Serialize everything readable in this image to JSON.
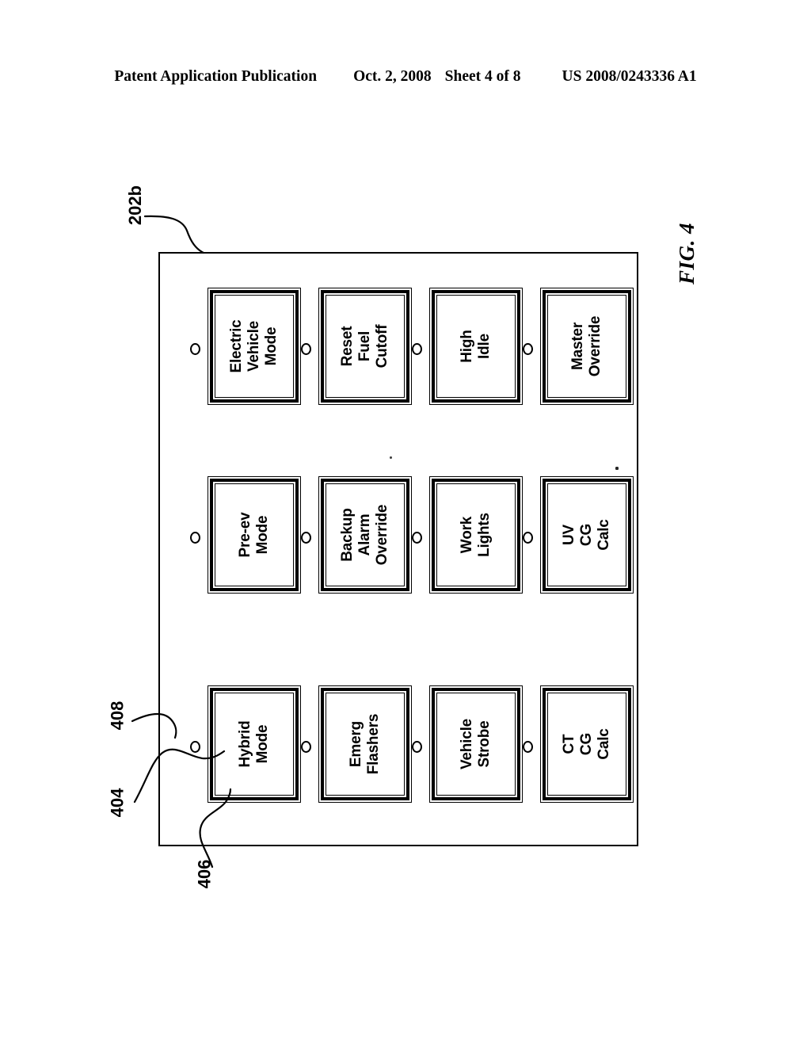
{
  "header": {
    "publication": "Patent Application Publication",
    "date": "Oct. 2, 2008",
    "sheet": "Sheet 4 of 8",
    "patent_number": "US 2008/0243336 A1"
  },
  "figure": {
    "label": "FIG. 4",
    "panel_ref": "202b",
    "callouts": [
      {
        "id": "408",
        "label": "408",
        "points_to": "led-indicator"
      },
      {
        "id": "404",
        "label": "404",
        "points_to": "button-face"
      },
      {
        "id": "406",
        "label": "406",
        "points_to": "button-frame"
      }
    ]
  },
  "panel": {
    "name": "switch-panel",
    "columns": [
      {
        "index": 0,
        "buttons": [
          {
            "name": "electric-vehicle-mode",
            "lines": [
              "Electric",
              "Vehicle",
              "Mode"
            ],
            "has_indicator": true
          },
          {
            "name": "reset-fuel-cutoff",
            "lines": [
              "Reset",
              "Fuel",
              "Cutoff"
            ],
            "has_indicator": true
          },
          {
            "name": "high-idle",
            "lines": [
              "High",
              "Idle"
            ],
            "has_indicator": true
          },
          {
            "name": "master-override",
            "lines": [
              "Master",
              "Override"
            ],
            "has_indicator": true
          }
        ]
      },
      {
        "index": 1,
        "buttons": [
          {
            "name": "pre-ev-mode",
            "lines": [
              "Pre-ev",
              "Mode"
            ],
            "has_indicator": true
          },
          {
            "name": "backup-alarm-override",
            "lines": [
              "Backup",
              "Alarm",
              "Override"
            ],
            "has_indicator": true
          },
          {
            "name": "work-lights",
            "lines": [
              "Work",
              "Lights"
            ],
            "has_indicator": true
          },
          {
            "name": "uv-cg-calc",
            "lines": [
              "UV",
              "CG",
              "Calc"
            ],
            "has_indicator": true
          }
        ]
      },
      {
        "index": 2,
        "buttons": [
          {
            "name": "hybrid-mode",
            "lines": [
              "Hybrid",
              "Mode"
            ],
            "has_indicator": true
          },
          {
            "name": "emerg-flashers",
            "lines": [
              "Emerg",
              "Flashers"
            ],
            "has_indicator": true
          },
          {
            "name": "vehicle-strobe",
            "lines": [
              "Vehicle",
              "Strobe"
            ],
            "has_indicator": true
          },
          {
            "name": "ct-cg-calc",
            "lines": [
              "CT",
              "CG",
              "Calc"
            ],
            "has_indicator": true
          }
        ]
      }
    ]
  },
  "colors": {
    "ink": "#000000",
    "paper": "#ffffff"
  }
}
